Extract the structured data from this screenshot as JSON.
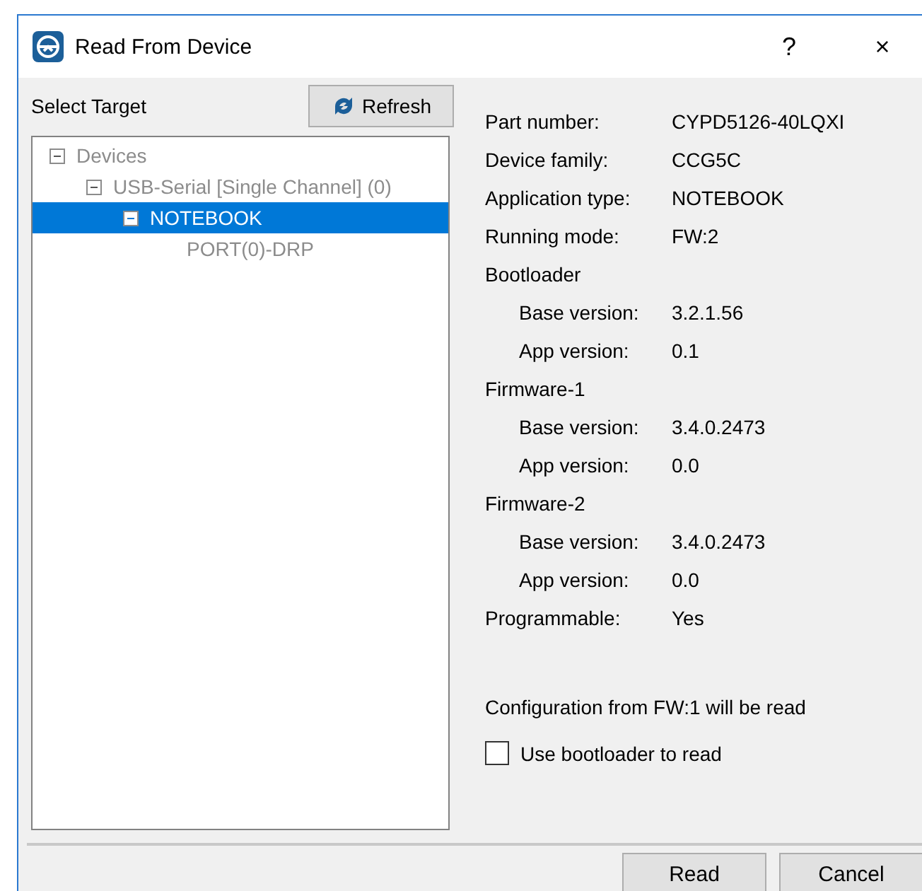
{
  "window": {
    "title": "Read From Device",
    "help": "?",
    "close": "×"
  },
  "target": {
    "label": "Select Target",
    "refresh": "Refresh"
  },
  "tree": [
    {
      "label": "Devices",
      "selected": false,
      "expanded": true,
      "children": [
        {
          "label": "USB-Serial [Single Channel] (0)",
          "selected": false,
          "expanded": true,
          "children": [
            {
              "label": "NOTEBOOK",
              "selected": true,
              "expanded": true,
              "children": [
                {
                  "label": "PORT(0)-DRP",
                  "selected": false
                }
              ]
            }
          ]
        }
      ]
    }
  ],
  "details": [
    {
      "kind": "field",
      "label": "Part number:",
      "value": "CYPD5126-40LQXI"
    },
    {
      "kind": "field",
      "label": "Device family:",
      "value": "CCG5C"
    },
    {
      "kind": "field",
      "label": "Application type:",
      "value": "NOTEBOOK"
    },
    {
      "kind": "field",
      "label": "Running mode:",
      "value": "FW:2"
    },
    {
      "kind": "group",
      "label": "Bootloader",
      "children": [
        {
          "label": "Base version:",
          "value": "3.2.1.56"
        },
        {
          "label": "App version:",
          "value": "0.1"
        }
      ]
    },
    {
      "kind": "group",
      "label": "Firmware-1",
      "children": [
        {
          "label": "Base version:",
          "value": "3.4.0.2473"
        },
        {
          "label": "App version:",
          "value": "0.0"
        }
      ]
    },
    {
      "kind": "group",
      "label": "Firmware-2",
      "children": [
        {
          "label": "Base version:",
          "value": "3.4.0.2473"
        },
        {
          "label": "App version:",
          "value": "0.0"
        }
      ]
    },
    {
      "kind": "field",
      "label": "Programmable:",
      "value": "Yes"
    }
  ],
  "note": "Configuration from FW:1 will be read",
  "use_bootloader": {
    "label": "Use bootloader to read",
    "checked": false
  },
  "buttons": [
    "Read",
    "Cancel"
  ]
}
